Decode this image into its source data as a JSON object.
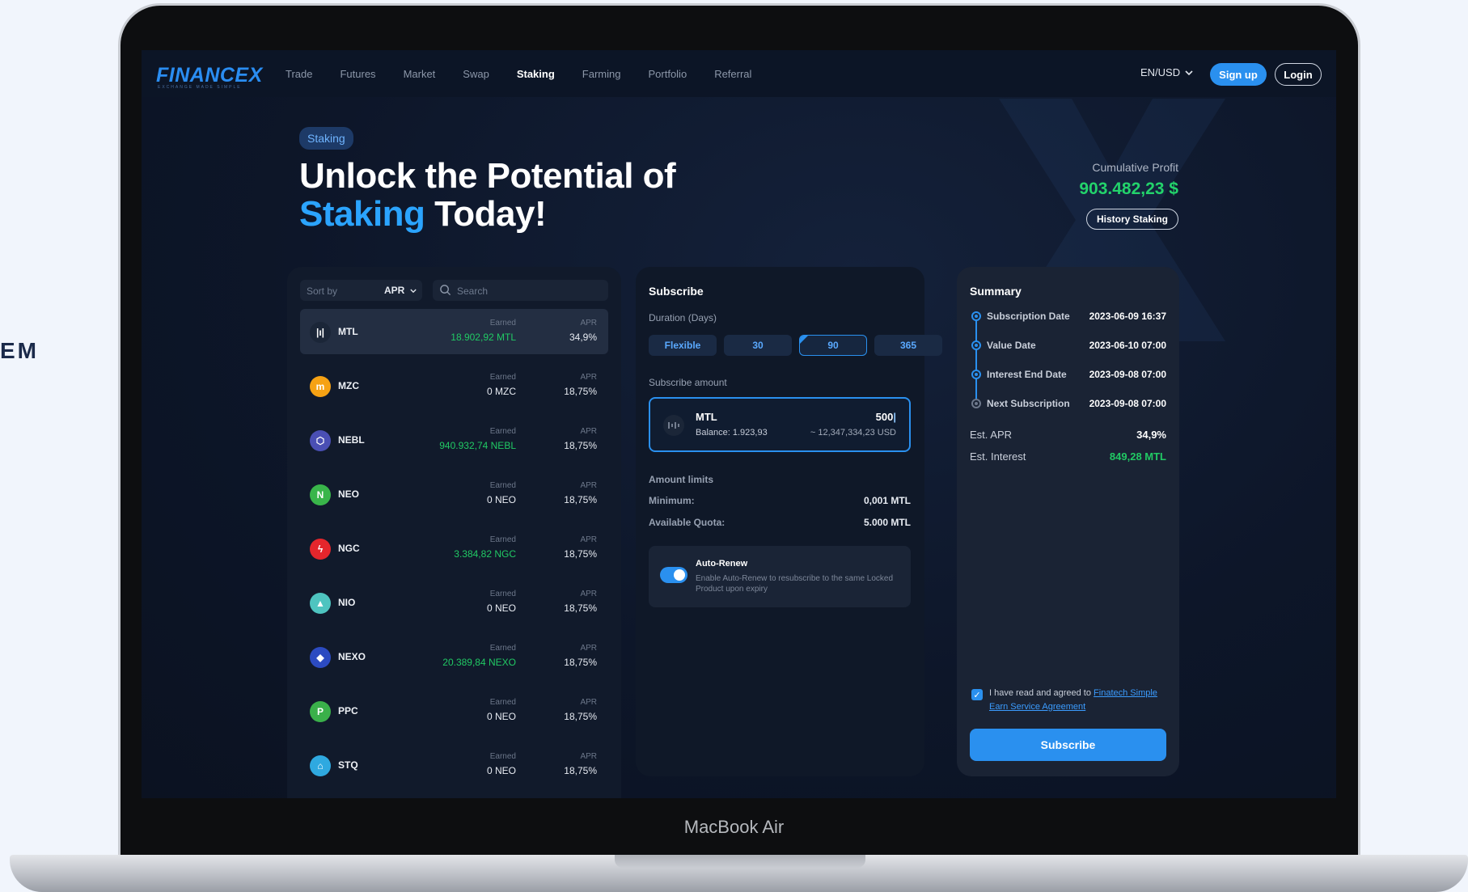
{
  "edge_text": "EM",
  "device_label": "MacBook Air",
  "brand": {
    "logo": "FINANCEX",
    "tagline": "EXCHANGE MADE SIMPLE",
    "color": "#2a8df2"
  },
  "nav": {
    "links": [
      "Trade",
      "Futures",
      "Market",
      "Swap",
      "Staking",
      "Farming",
      "Portfolio",
      "Referral"
    ],
    "active": "Staking",
    "lang": "EN/USD",
    "signup": "Sign up",
    "login": "Login"
  },
  "hero": {
    "pill": "Staking",
    "line1": "Unlock the Potential of",
    "accent": "Staking",
    "rest": " Today!",
    "cumulative_label": "Cumulative Profit",
    "cumulative_value": "903.482,23 $",
    "history_button": "History Staking"
  },
  "list": {
    "sort_label": "Sort by",
    "sort_value": "APR",
    "search_placeholder": "Search",
    "earned_label": "Earned",
    "apr_label": "APR",
    "rows": [
      {
        "coin": "MTL",
        "earned": "18.902,92 MTL",
        "apr": "34,9%",
        "icon": "mtl-icon",
        "color": "#1b2638",
        "glyph": "|ı|",
        "green": true,
        "selected": true
      },
      {
        "coin": "MZC",
        "earned": "0 MZC",
        "apr": "18,75%",
        "icon": "mzc-icon",
        "color": "#f6a214",
        "glyph": "m",
        "green": false
      },
      {
        "coin": "NEBL",
        "earned": "940.932,74 NEBL",
        "apr": "18,75%",
        "icon": "nebl-icon",
        "color": "#4a4fb4",
        "glyph": "⬡",
        "green": true
      },
      {
        "coin": "NEO",
        "earned": "0 NEO",
        "apr": "18,75%",
        "icon": "neo-icon",
        "color": "#39b54a",
        "glyph": "N",
        "green": false
      },
      {
        "coin": "NGC",
        "earned": "3.384,82 NGC",
        "apr": "18,75%",
        "icon": "ngc-icon",
        "color": "#e4262c",
        "glyph": "ϟ",
        "green": true
      },
      {
        "coin": "NIO",
        "earned": "0 NEO",
        "apr": "18,75%",
        "icon": "nio-icon",
        "color": "#4ec4c0",
        "glyph": "▲",
        "green": false
      },
      {
        "coin": "NEXO",
        "earned": "20.389,84 NEXO",
        "apr": "18,75%",
        "icon": "nexo-icon",
        "color": "#2c4bc1",
        "glyph": "◆",
        "green": true
      },
      {
        "coin": "PPC",
        "earned": "0 NEO",
        "apr": "18,75%",
        "icon": "ppc-icon",
        "color": "#3ab04a",
        "glyph": "P",
        "green": false
      },
      {
        "coin": "STQ",
        "earned": "0 NEO",
        "apr": "18,75%",
        "icon": "stq-icon",
        "color": "#2fa9e0",
        "glyph": "⌂",
        "green": false
      }
    ]
  },
  "subscribe": {
    "title": "Subscribe",
    "duration_label": "Duration (Days)",
    "durations": [
      "Flexible",
      "30",
      "90",
      "365"
    ],
    "active_duration": "90",
    "amount_label": "Subscribe amount",
    "coin": "MTL",
    "balance": "Balance: 1.923,93",
    "amount": "500",
    "usd": "~ 12,347,334,23 USD",
    "limits_title": "Amount limits",
    "minimum_label": "Minimum:",
    "minimum_value": "0,001 MTL",
    "quota_label": "Available Quota:",
    "quota_value": "5.000 MTL",
    "auto_title": "Auto-Renew",
    "auto_desc": "Enable Auto-Renew to resubscribe to the same Locked Product upon expiry",
    "auto_on": true
  },
  "summary": {
    "title": "Summary",
    "timeline": [
      {
        "label": "Subscription Date",
        "value": "2023-06-09 16:37"
      },
      {
        "label": "Value Date",
        "value": "2023-06-10 07:00"
      },
      {
        "label": "Interest End Date",
        "value": "2023-09-08 07:00"
      },
      {
        "label": "Next Subscription",
        "value": "2023-09-08 07:00"
      }
    ],
    "est_apr_label": "Est. APR",
    "est_apr_value": "34,9%",
    "est_interest_label": "Est. Interest",
    "est_interest_value": "849,28 MTL",
    "agree_text": "I have read and agreed to ",
    "agree_link": "Finatech Simple Earn Service Agreement",
    "button": "Subscribe"
  },
  "colors": {
    "accent": "#2a90ef",
    "positive": "#23d36b",
    "panel": "#111a2b"
  }
}
